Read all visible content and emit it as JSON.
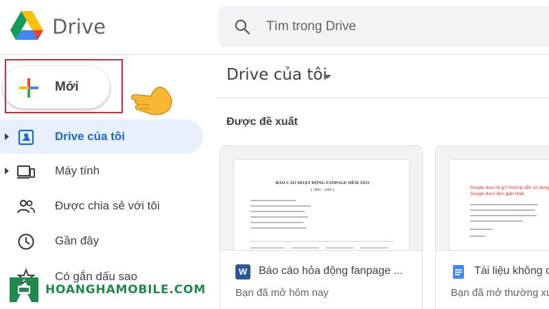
{
  "header": {
    "app_title": "Drive",
    "search_placeholder": "Tìm trong Drive"
  },
  "sidebar": {
    "new_label": "Mới",
    "items": [
      {
        "label": "Drive của tôi",
        "icon": "my-drive-icon",
        "active": true,
        "expandable": true
      },
      {
        "label": "Máy tính",
        "icon": "computers-icon",
        "active": false,
        "expandable": true
      },
      {
        "label": "Được chia sẻ với tôi",
        "icon": "shared-with-me-icon",
        "active": false,
        "expandable": false
      },
      {
        "label": "Gần đây",
        "icon": "recent-clock-icon",
        "active": false,
        "expandable": false
      },
      {
        "label": "Có gắn dấu sao",
        "icon": "starred-icon",
        "active": false,
        "expandable": false
      }
    ]
  },
  "main": {
    "title": "Drive của tôi",
    "section_label": "Được đề xuất",
    "cards": [
      {
        "name": "Báo cáo hỏa động fanpage ...",
        "subtitle": "Bạn đã mở hôm nay",
        "icon": "word-doc-icon",
        "icon_letter": "W",
        "icon_color": "#2b579a",
        "preview_heading": "BÁO CÁO HOẠT ĐỘNG FANPAGE HÊM XÈO",
        "preview_subheading": "( 18/6 – 24/6 )"
      },
      {
        "name": "Tài liệu không c",
        "subtitle": "Bạn đã mở thường xu",
        "icon": "google-docs-icon",
        "icon_color": "#4285f4",
        "preview_text": "Google docs là gì? Hướng dẫn sử dụng Google docs đơn giản nhất"
      }
    ]
  },
  "watermark": {
    "brand": "HOANGHAMOBILE.COM",
    "color": "#1f8a4c"
  },
  "colors": {
    "accent": "#1967d2",
    "active_bg": "#e8f0fe",
    "highlight_box": "#e0262b"
  }
}
